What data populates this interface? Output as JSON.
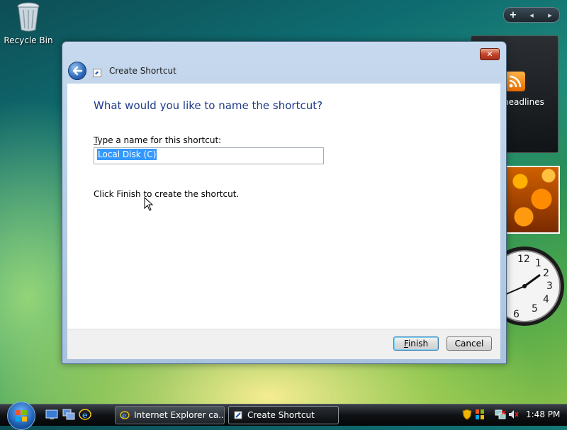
{
  "desktop": {
    "recycle_bin_label": "Recycle Bin"
  },
  "sidebar": {
    "plus_label": "+",
    "prev_label": "◂",
    "next_label": "▸",
    "feed_text": "headlines",
    "clock_numbers": [
      "1",
      "2",
      "3",
      "4",
      "5",
      "6",
      "12"
    ]
  },
  "dialog": {
    "close_label": "✕",
    "title": "Create Shortcut",
    "heading": "What would you like to name the shortcut?",
    "name_label_first": "T",
    "name_label_rest": "ype a name for this shortcut:",
    "name_value": "Local Disk (C)",
    "finish_text": "Click Finish to create the shortcut.",
    "finish_label_first": "F",
    "finish_label_rest": "inish",
    "cancel_label": "Cancel"
  },
  "taskbar": {
    "tasks": [
      {
        "label": "Internet Explorer ca..."
      },
      {
        "label": "Create Shortcut"
      }
    ],
    "clock": "1:48 PM"
  }
}
